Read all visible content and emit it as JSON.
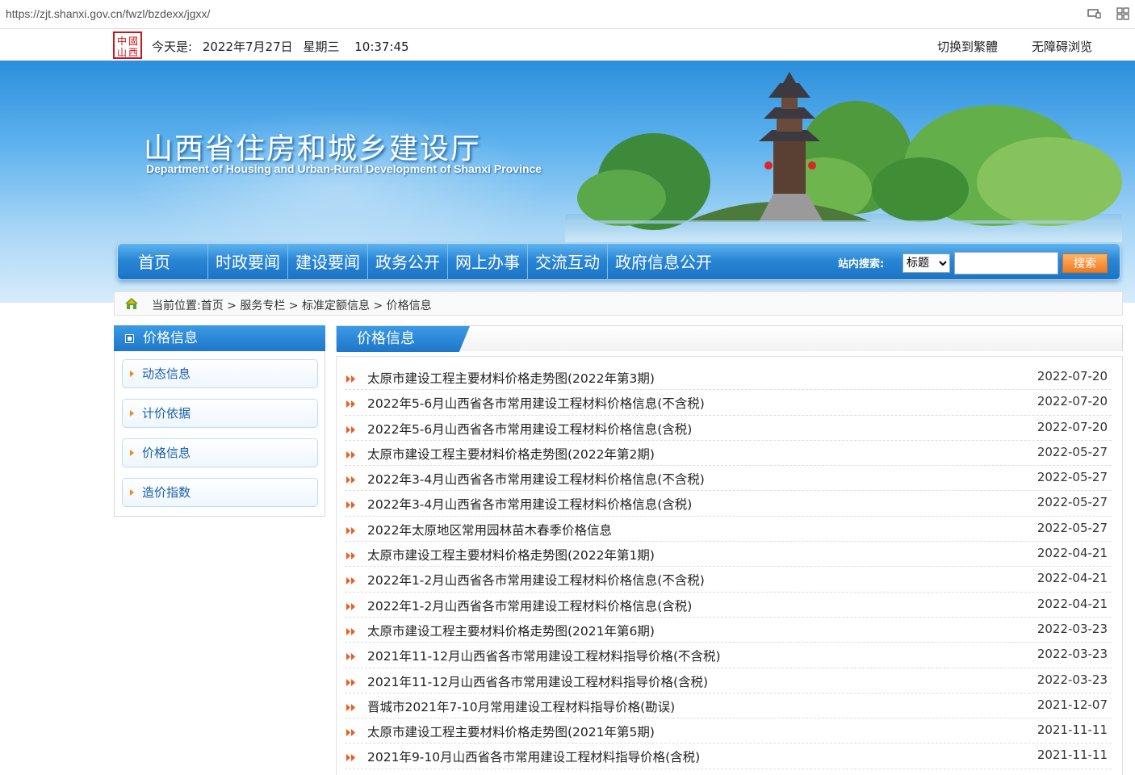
{
  "browser": {
    "url": "https://zjt.shanxi.gov.cn/fwzl/bzdexx/jgxx/"
  },
  "topbar": {
    "seal_text": "中國山西",
    "today_label": "今天是:",
    "date": "2022年7月27日",
    "weekday": "星期三",
    "time": "10:37:45",
    "switch_traditional": "切换到繁體",
    "accessibility": "无障碍浏览"
  },
  "banner": {
    "title": "山西省住房和城乡建设厅",
    "subtitle": "Department of Housing and Urban-Rural Development of Shanxi Province"
  },
  "nav": {
    "items": [
      "首页",
      "时政要闻",
      "建设要闻",
      "政务公开",
      "网上办事",
      "交流互动",
      "政府信息公开"
    ],
    "search_label": "站内搜索:",
    "search_option": "标题",
    "search_button": "搜索"
  },
  "breadcrumb": {
    "text": "当前位置:首页 > 服务专栏 > 标准定额信息 > 价格信息"
  },
  "sidebar": {
    "title": "价格信息",
    "items": [
      "动态信息",
      "计价依据",
      "价格信息",
      "造价指数"
    ]
  },
  "main": {
    "title": "价格信息",
    "articles": [
      {
        "title": "太原市建设工程主要材料价格走势图(2022年第3期)",
        "date": "2022-07-20"
      },
      {
        "title": "2022年5-6月山西省各市常用建设工程材料价格信息(不含税)",
        "date": "2022-07-20"
      },
      {
        "title": "2022年5-6月山西省各市常用建设工程材料价格信息(含税)",
        "date": "2022-07-20"
      },
      {
        "title": "太原市建设工程主要材料价格走势图(2022年第2期)",
        "date": "2022-05-27"
      },
      {
        "title": "2022年3-4月山西省各市常用建设工程材料价格信息(不含税)",
        "date": "2022-05-27"
      },
      {
        "title": "2022年3-4月山西省各市常用建设工程材料价格信息(含税)",
        "date": "2022-05-27"
      },
      {
        "title": "2022年太原地区常用园林苗木春季价格信息",
        "date": "2022-05-27"
      },
      {
        "title": "太原市建设工程主要材料价格走势图(2022年第1期)",
        "date": "2022-04-21"
      },
      {
        "title": "2022年1-2月山西省各市常用建设工程材料价格信息(不含税)",
        "date": "2022-04-21"
      },
      {
        "title": "2022年1-2月山西省各市常用建设工程材料价格信息(含税)",
        "date": "2022-04-21"
      },
      {
        "title": "太原市建设工程主要材料价格走势图(2021年第6期)",
        "date": "2022-03-23"
      },
      {
        "title": "2021年11-12月山西省各市常用建设工程材料指导价格(不含税)",
        "date": "2022-03-23"
      },
      {
        "title": "2021年11-12月山西省各市常用建设工程材料指导价格(含税)",
        "date": "2022-03-23"
      },
      {
        "title": "晋城市2021年7-10月常用建设工程材料指导价格(勘误)",
        "date": "2021-12-07"
      },
      {
        "title": "太原市建设工程主要材料价格走势图(2021年第5期)",
        "date": "2021-11-11"
      },
      {
        "title": "2021年9-10月山西省各市常用建设工程材料指导价格(含税)",
        "date": "2021-11-11"
      }
    ]
  },
  "colors": {
    "nav_blue": "#1f76c9",
    "link_blue": "#1a5fa8",
    "arrow_orange": "#f05a1e",
    "search_orange": "#f07a1e"
  }
}
